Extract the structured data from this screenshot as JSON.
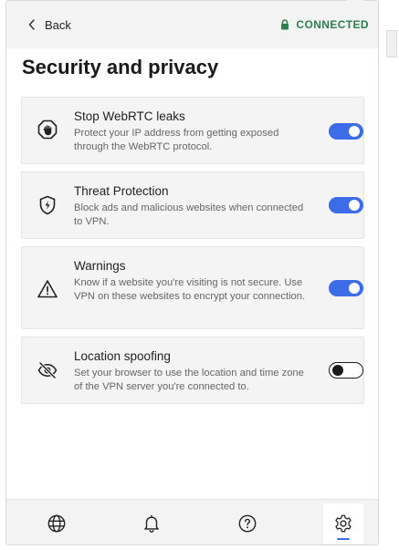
{
  "header": {
    "back_label": "Back",
    "back_icon": "chevron-left-icon",
    "status_label": "CONNECTED",
    "status_icon": "lock-icon",
    "status_color": "#2e7d4f"
  },
  "page_title": "Security and privacy",
  "settings": [
    {
      "title": "Stop WebRTC leaks",
      "description": "Protect your IP address from getting exposed through the WebRTC protocol.",
      "icon": "hand-stop-icon",
      "enabled": true
    },
    {
      "title": "Threat Protection",
      "description": "Block ads and malicious websites when connected to VPN.",
      "icon": "shield-bolt-icon",
      "enabled": true
    },
    {
      "title": "Warnings",
      "description": "Know if a website you're visiting is not secure. Use VPN on these websites to encrypt your connection.",
      "icon": "warning-triangle-icon",
      "enabled": true
    },
    {
      "title": "Location spoofing",
      "description": "Set your browser to use the location and time zone of the VPN server you're connected to.",
      "icon": "eye-off-icon",
      "enabled": false
    }
  ],
  "bottom_nav": [
    {
      "icon": "globe-icon",
      "active": false
    },
    {
      "icon": "bell-icon",
      "active": false
    },
    {
      "icon": "help-circle-icon",
      "active": false
    },
    {
      "icon": "gear-icon",
      "active": true
    }
  ],
  "colors": {
    "accent": "#3d6ce8",
    "card_background": "#f4f4f4",
    "header_background": "#f3f3f3"
  }
}
